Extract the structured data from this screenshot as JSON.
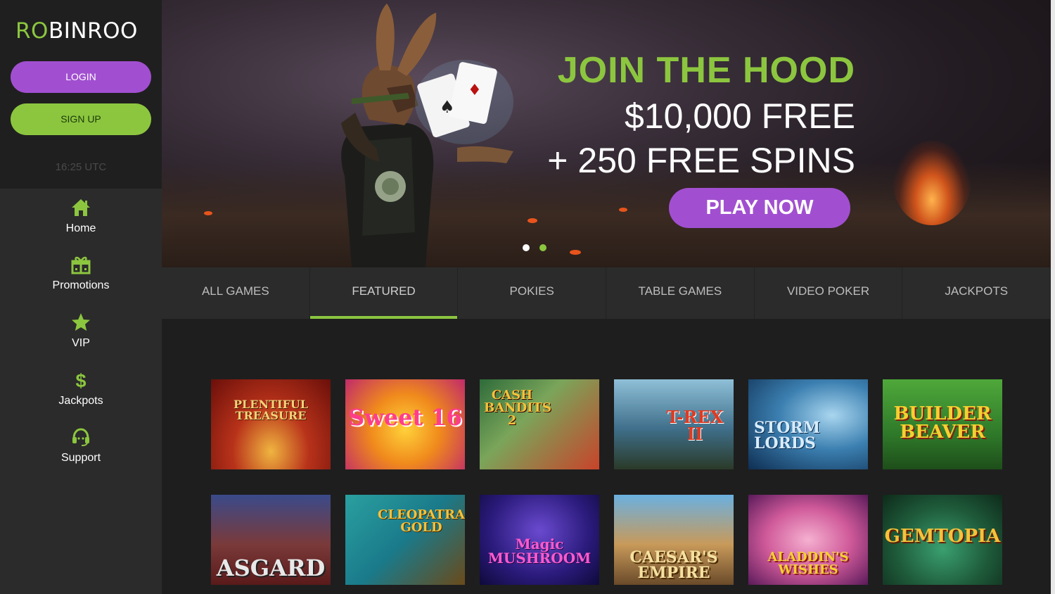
{
  "sidebar": {
    "logo": {
      "part1": "R",
      "part2": "O",
      "part3": "BINROO"
    },
    "login_label": "LOGIN",
    "signup_label": "SIGN UP",
    "time_text": "16:25 UTC",
    "nav": [
      {
        "label": "Home",
        "icon": "home-icon"
      },
      {
        "label": "Promotions",
        "icon": "gift-icon"
      },
      {
        "label": "VIP",
        "icon": "star-icon"
      },
      {
        "label": "Jackpots",
        "icon": "dollar-icon"
      },
      {
        "label": "Support",
        "icon": "headset-icon"
      }
    ]
  },
  "hero": {
    "line1": "JOIN THE HOOD",
    "line2": "$10,000 FREE",
    "line3": "+ 250 FREE SPINS",
    "cta": "PLAY NOW",
    "slides": 2,
    "active_slide": 2
  },
  "tabs": [
    {
      "label": "ALL GAMES"
    },
    {
      "label": "FEATURED",
      "active": true
    },
    {
      "label": "POKIES"
    },
    {
      "label": "TABLE GAMES"
    },
    {
      "label": "VIDEO POKER"
    },
    {
      "label": "JACKPOTS"
    }
  ],
  "games": [
    {
      "title": "PLENTIFUL TREASURE"
    },
    {
      "title": "Sweet 16"
    },
    {
      "title": "CASH BANDITS 2"
    },
    {
      "title": "T-REX II"
    },
    {
      "title": "STORM LORDS"
    },
    {
      "title": "BUILDER BEAVER"
    },
    {
      "title": "ASGARD"
    },
    {
      "title": "CLEOPATRA'S GOLD"
    },
    {
      "title": "Magic MUSHROOM"
    },
    {
      "title": "CAESAR'S EMPIRE"
    },
    {
      "title": "ALADDIN'S WISHES"
    },
    {
      "title": "GEMTOPIA"
    }
  ],
  "colors": {
    "accent_green": "#8cc63f",
    "accent_purple": "#a14fd0",
    "sidebar_bg": "#2b2b2b",
    "page_bg": "#1e1e1e"
  }
}
